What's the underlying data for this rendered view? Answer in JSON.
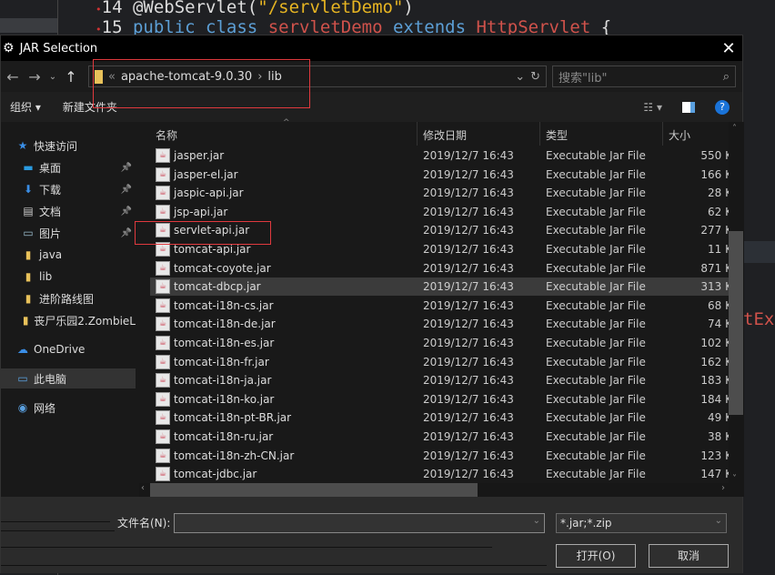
{
  "editor": {
    "line14_num": "14",
    "line14_annotation": "@WebServlet(",
    "line14_string": "\"/servletDemo\"",
    "line14_close": ")",
    "line15_num": "15",
    "line15_kw": "public class ",
    "line15_class": "servletDemo",
    "line15_extends": " extends ",
    "line15_super": "HttpServlet",
    "line15_brace": " {",
    "partial_text": "tEx"
  },
  "dialog": {
    "title": "JAR Selection",
    "close": "✕",
    "address": {
      "prefix": "«",
      "segments": [
        "apache-tomcat-9.0.30",
        "lib"
      ],
      "separator": "›"
    },
    "search_placeholder": "搜索\"lib\"",
    "toolbar": {
      "organize": "组织 ▾",
      "new_folder": "新建文件夹"
    },
    "sidebar": [
      {
        "label": "快速访问",
        "icon": "star-icon"
      },
      {
        "label": "桌面",
        "icon": "desktop-icon",
        "pinned": true
      },
      {
        "label": "下载",
        "icon": "download-icon",
        "pinned": true
      },
      {
        "label": "文档",
        "icon": "document-icon",
        "pinned": true
      },
      {
        "label": "图片",
        "icon": "pictures-icon",
        "pinned": true
      },
      {
        "label": "java",
        "icon": "folder-icon"
      },
      {
        "label": "lib",
        "icon": "folder-icon"
      },
      {
        "label": "进阶路线图",
        "icon": "folder-icon"
      },
      {
        "label": "丧尸乐园2.ZombieL",
        "icon": "folder-icon"
      },
      {
        "label": "OneDrive",
        "icon": "cloud-icon"
      },
      {
        "label": "此电脑",
        "icon": "computer-icon",
        "selected": true
      },
      {
        "label": "网络",
        "icon": "network-icon"
      }
    ],
    "columns": [
      "名称",
      "修改日期",
      "类型",
      "大小"
    ],
    "files": [
      {
        "name": "jasper.jar",
        "date": "2019/12/7 16:43",
        "type": "Executable Jar File",
        "size": "550 K"
      },
      {
        "name": "jasper-el.jar",
        "date": "2019/12/7 16:43",
        "type": "Executable Jar File",
        "size": "166 K"
      },
      {
        "name": "jaspic-api.jar",
        "date": "2019/12/7 16:43",
        "type": "Executable Jar File",
        "size": "28 K"
      },
      {
        "name": "jsp-api.jar",
        "date": "2019/12/7 16:43",
        "type": "Executable Jar File",
        "size": "62 K"
      },
      {
        "name": "servlet-api.jar",
        "date": "2019/12/7 16:43",
        "type": "Executable Jar File",
        "size": "277 K"
      },
      {
        "name": "tomcat-api.jar",
        "date": "2019/12/7 16:43",
        "type": "Executable Jar File",
        "size": "11 K"
      },
      {
        "name": "tomcat-coyote.jar",
        "date": "2019/12/7 16:43",
        "type": "Executable Jar File",
        "size": "871 K"
      },
      {
        "name": "tomcat-dbcp.jar",
        "date": "2019/12/7 16:43",
        "type": "Executable Jar File",
        "size": "313 K",
        "selected": true
      },
      {
        "name": "tomcat-i18n-cs.jar",
        "date": "2019/12/7 16:43",
        "type": "Executable Jar File",
        "size": "68 K"
      },
      {
        "name": "tomcat-i18n-de.jar",
        "date": "2019/12/7 16:43",
        "type": "Executable Jar File",
        "size": "74 K"
      },
      {
        "name": "tomcat-i18n-es.jar",
        "date": "2019/12/7 16:43",
        "type": "Executable Jar File",
        "size": "102 K"
      },
      {
        "name": "tomcat-i18n-fr.jar",
        "date": "2019/12/7 16:43",
        "type": "Executable Jar File",
        "size": "162 K"
      },
      {
        "name": "tomcat-i18n-ja.jar",
        "date": "2019/12/7 16:43",
        "type": "Executable Jar File",
        "size": "183 K"
      },
      {
        "name": "tomcat-i18n-ko.jar",
        "date": "2019/12/7 16:43",
        "type": "Executable Jar File",
        "size": "184 K"
      },
      {
        "name": "tomcat-i18n-pt-BR.jar",
        "date": "2019/12/7 16:43",
        "type": "Executable Jar File",
        "size": "49 K"
      },
      {
        "name": "tomcat-i18n-ru.jar",
        "date": "2019/12/7 16:43",
        "type": "Executable Jar File",
        "size": "38 K"
      },
      {
        "name": "tomcat-i18n-zh-CN.jar",
        "date": "2019/12/7 16:43",
        "type": "Executable Jar File",
        "size": "123 K"
      },
      {
        "name": "tomcat-jdbc.jar",
        "date": "2019/12/7 16:43",
        "type": "Executable Jar File",
        "size": "147 K"
      }
    ],
    "filename_label": "文件名(N):",
    "filename_value": "",
    "filetype": "*.jar;*.zip",
    "open_button": "打开(O)",
    "cancel_button": "取消",
    "highlight_color": "#e0393e"
  }
}
